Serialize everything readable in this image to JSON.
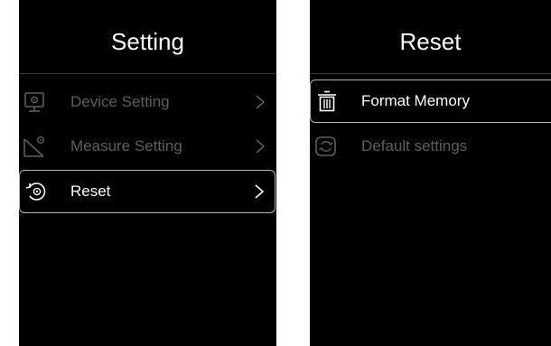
{
  "left_panel": {
    "title": "Setting",
    "items": [
      {
        "label": "Device Setting",
        "icon": "monitor-gear-icon",
        "selected": false
      },
      {
        "label": "Measure Setting",
        "icon": "ruler-gear-icon",
        "selected": false
      },
      {
        "label": "Reset",
        "icon": "reset-gear-icon",
        "selected": true
      }
    ]
  },
  "right_panel": {
    "title": "Reset",
    "items": [
      {
        "label": "Format Memory",
        "icon": "trash-icon",
        "selected": true
      },
      {
        "label": "Default settings",
        "icon": "refresh-icon",
        "selected": false
      }
    ]
  },
  "colors": {
    "background": "#000000",
    "text_active": "#ffffff",
    "text_inactive": "#5e5e5e",
    "highlight_border": "#b5b5b5"
  }
}
